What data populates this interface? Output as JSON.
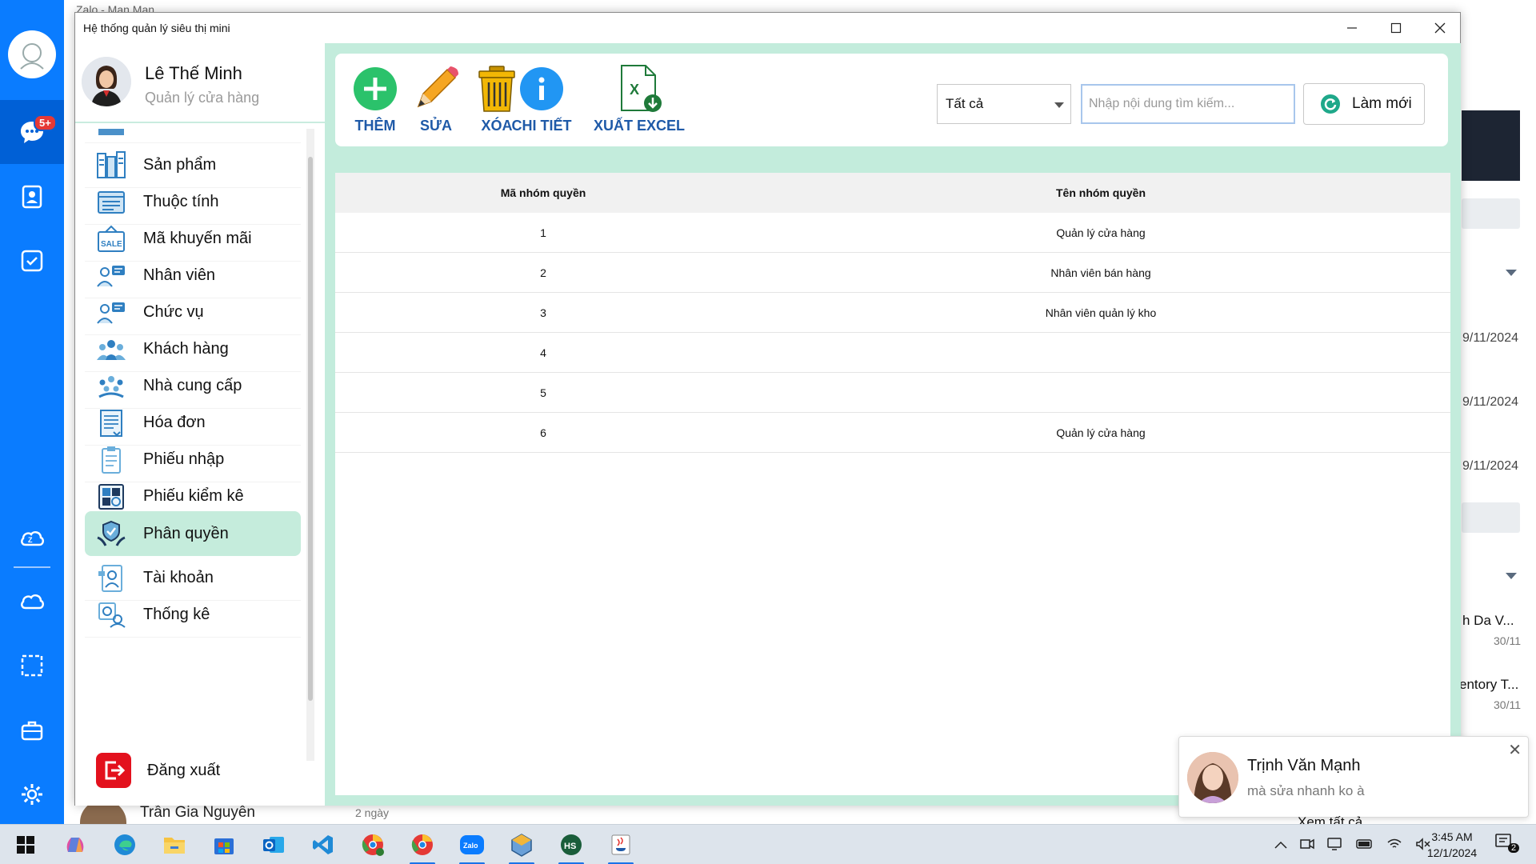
{
  "zalo": {
    "window_title": "Zalo - Mạn Mạn",
    "badge": "5+",
    "dates": [
      "9/11/2024",
      "9/11/2024",
      "9/11/2024"
    ],
    "chat_previews": [
      {
        "name": "h Da V...",
        "date": "30/11"
      },
      {
        "name": "entory T...",
        "date": "30/11"
      }
    ],
    "see_all": "Xem tất cả",
    "bottom_contact": {
      "name": "Trần Gia Nguyễn",
      "time": "2 ngày"
    }
  },
  "app": {
    "title": "Hệ thống quản lý siêu thị mini",
    "user": {
      "name": "Lê Thế Minh",
      "role": "Quản lý cửa hàng"
    },
    "menu": [
      {
        "label": "Sản phẩm",
        "icon": "product-icon"
      },
      {
        "label": "Thuộc tính",
        "icon": "attribute-icon"
      },
      {
        "label": "Mã khuyến mãi",
        "icon": "sale-tag-icon"
      },
      {
        "label": "Nhân viên",
        "icon": "employee-icon"
      },
      {
        "label": "Chức vụ",
        "icon": "position-icon"
      },
      {
        "label": "Khách hàng",
        "icon": "customers-icon"
      },
      {
        "label": "Nhà cung cấp",
        "icon": "supplier-icon"
      },
      {
        "label": "Hóa đơn",
        "icon": "invoice-icon"
      },
      {
        "label": "Phiếu nhập",
        "icon": "import-slip-icon"
      },
      {
        "label": "Phiếu kiểm kê",
        "icon": "inventory-check-icon"
      },
      {
        "label": "Phân quyền",
        "icon": "permission-icon"
      },
      {
        "label": "Tài khoản",
        "icon": "account-icon"
      },
      {
        "label": "Thống kê",
        "icon": "statistics-icon"
      }
    ],
    "active_menu": "Phân quyền",
    "logout_label": "Đăng xuất",
    "toolbar": {
      "add": "THÊM",
      "edit": "SỬA",
      "delete": "XÓA",
      "detail": "CHI TIẾT",
      "export": "XUẤT EXCEL"
    },
    "filter": {
      "selected": "Tất cả"
    },
    "search": {
      "placeholder": "Nhập nội dung tìm kiếm...",
      "value": ""
    },
    "refresh_label": "Làm mới",
    "table": {
      "headers": [
        "Mã nhóm quyền",
        "Tên nhóm quyền"
      ],
      "rows": [
        [
          "1",
          "Quản lý cửa hàng"
        ],
        [
          "2",
          "Nhân viên bán hàng"
        ],
        [
          "3",
          "Nhân viên quản lý kho"
        ],
        [
          "4",
          ""
        ],
        [
          "5",
          ""
        ],
        [
          "6",
          "Quản lý cửa hàng"
        ]
      ]
    }
  },
  "notification": {
    "sender": "Trịnh Văn Mạnh",
    "message": "mà sửa nhanh ko à"
  },
  "taskbar": {
    "time": "3:45 AM",
    "date": "12/1/2024",
    "notification_count": "2",
    "apps": [
      "start",
      "copilot",
      "edge",
      "file-explorer",
      "store",
      "outlook",
      "vscode",
      "chrome-m",
      "chrome",
      "zalo",
      "app-hex",
      "hs",
      "java"
    ]
  },
  "colors": {
    "accent_green": "#c3ecdc",
    "zalo_blue": "#0a7cff",
    "toolbar_text": "#1f5aa8",
    "logout_red": "#e3111d"
  }
}
